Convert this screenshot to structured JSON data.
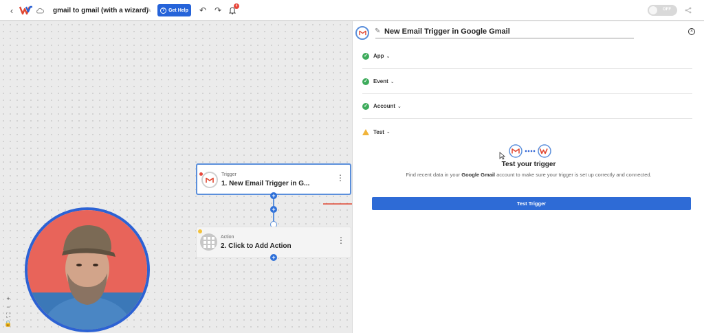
{
  "topbar": {
    "workflow_title": "gmail to gmail (with a wizard)",
    "help_label": "Get Help",
    "notification_count": "4",
    "toggle_label": "OFF"
  },
  "canvas": {
    "trigger_node": {
      "type": "Trigger",
      "title": "1. New Email Trigger in G..."
    },
    "action_node": {
      "type": "Action",
      "title": "2. Click to Add Action"
    },
    "zoom_controls": [
      "+",
      "−",
      "⛶",
      "🔒"
    ]
  },
  "panel": {
    "title": "New Email Trigger in Google Gmail",
    "sections": [
      {
        "label": "App",
        "status": "complete"
      },
      {
        "label": "Event",
        "status": "complete"
      },
      {
        "label": "Account",
        "status": "complete"
      },
      {
        "label": "Test",
        "status": "warning"
      }
    ],
    "test": {
      "heading": "Test your trigger",
      "desc_prefix": "Find recent data in your ",
      "desc_app": "Google Gmail",
      "desc_suffix": " account to make sure your trigger is set up correctly and connected.",
      "button_label": "Test Trigger"
    }
  },
  "colors": {
    "primary": "#2e6bd6",
    "success": "#3dab5b",
    "warning": "#f1b43a",
    "arrow": "#e0452f"
  }
}
